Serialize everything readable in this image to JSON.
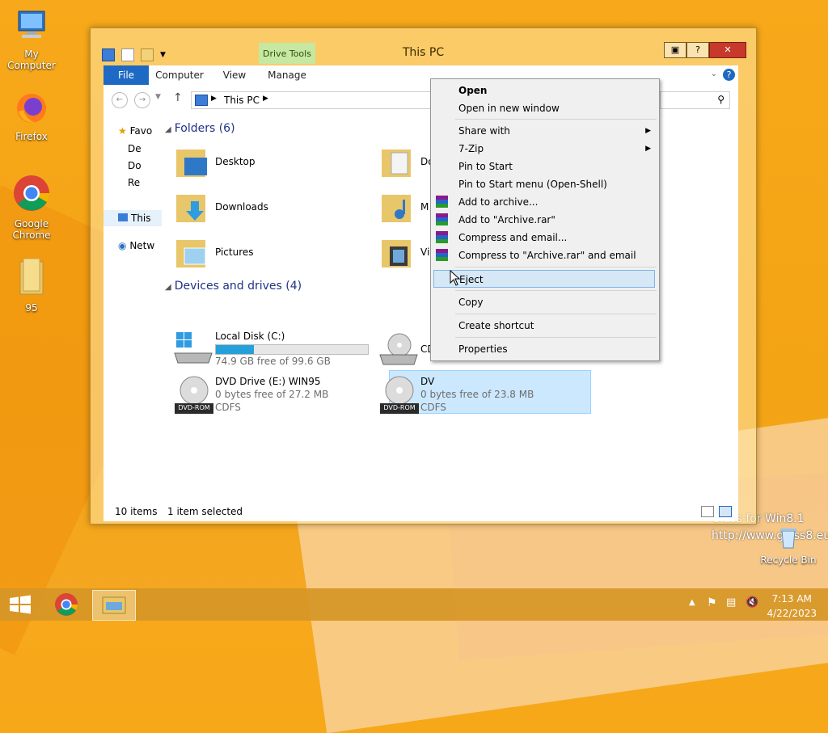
{
  "desktop": {
    "icons": [
      {
        "label": "My Computer"
      },
      {
        "label": "Firefox"
      },
      {
        "label": "Google Chrome"
      },
      {
        "label": "95"
      }
    ],
    "recycle_bin": "Recycle Bin",
    "watermark_line1": "Glass for Win8.1",
    "watermark_line2": "http://www.glass8.eu"
  },
  "window": {
    "title": "This PC",
    "contextual_tab": "Drive Tools",
    "ribbon_tabs": [
      "File",
      "Computer",
      "View",
      "Manage"
    ],
    "address": "This PC",
    "nav_pane": [
      "Favo",
      "De",
      "Do",
      "Re",
      "This",
      "Netw"
    ],
    "folders_header": "Folders (6)",
    "folders": [
      "Desktop",
      "Downloads",
      "Pictures",
      "Do",
      "M",
      "Vi"
    ],
    "drives_header": "Devices and drives (4)",
    "drives": [
      {
        "name": "Local Disk (C:)",
        "sub1": "74.9 GB free of 99.6 GB",
        "used_fraction": 0.25
      },
      {
        "name": "CD",
        "sub1": ""
      },
      {
        "name": "DVD Drive (E:) WIN95",
        "sub1": "0 bytes free of 27.2 MB",
        "sub2": "CDFS",
        "badge": "DVD-ROM"
      },
      {
        "name": "DV",
        "sub1": "0 bytes free of 23.8 MB",
        "sub2": "CDFS",
        "badge": "DVD-ROM"
      }
    ],
    "status_items": "10 items",
    "status_selected": "1 item selected"
  },
  "context_menu": {
    "items": [
      {
        "label": "Open"
      },
      {
        "label": "Open in new window"
      },
      {
        "label": "Share with"
      },
      {
        "label": "7-Zip"
      },
      {
        "label": "Pin to Start"
      },
      {
        "label": "Pin to Start menu (Open-Shell)"
      },
      {
        "label": "Add to archive..."
      },
      {
        "label": "Add to \"Archive.rar\""
      },
      {
        "label": "Compress and email..."
      },
      {
        "label": "Compress to \"Archive.rar\" and email"
      },
      {
        "label": "Eject"
      },
      {
        "label": "Copy"
      },
      {
        "label": "Create shortcut"
      },
      {
        "label": "Properties"
      }
    ]
  },
  "taskbar": {
    "time": "7:13 AM",
    "date": "4/22/2023"
  },
  "colors": {
    "accent": "#1e69c3",
    "selection": "#cce8ff",
    "drive_bar": "#26a0da",
    "close_button": "#c7392b"
  }
}
